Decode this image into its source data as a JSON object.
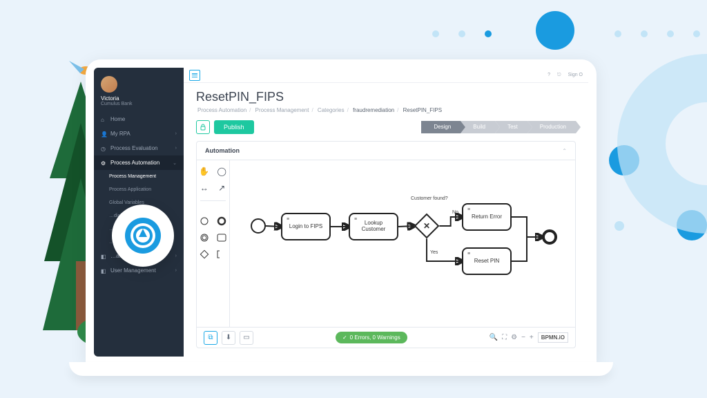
{
  "user": {
    "name": "Victoria",
    "subtitle": "Cumulus Bank"
  },
  "topbar": {
    "help": "?",
    "signout_icon": "⎋",
    "signout_label": "Sign O"
  },
  "sidebar": {
    "items": [
      {
        "icon": "⌂",
        "label": "Home"
      },
      {
        "icon": "👤",
        "label": "My RPA"
      },
      {
        "icon": "◷",
        "label": "Process Evaluation"
      },
      {
        "icon": "⚙",
        "label": "Process Automation",
        "active": true
      },
      {
        "icon": "",
        "label": "Process Management",
        "sub": true,
        "active": true
      },
      {
        "icon": "",
        "label": "Process Application",
        "sub": true
      },
      {
        "icon": "",
        "label": "Global Variables",
        "sub": true
      },
      {
        "icon": "",
        "label": "…dial Pool",
        "sub": true
      },
      {
        "icon": "",
        "label": "…ations",
        "sub": true
      },
      {
        "icon": "",
        "label": "…oring",
        "sub": true
      },
      {
        "icon": "◧",
        "label": "…anagement"
      },
      {
        "icon": "◧",
        "label": "User Management"
      }
    ]
  },
  "header": {
    "title": "ResetPIN_FIPS",
    "breadcrumb": [
      "Process Automation",
      "Process Management",
      "Categories",
      "fraudremediation",
      "ResetPIN_FIPS"
    ]
  },
  "actions": {
    "publish": "Publish"
  },
  "stages": [
    "Design",
    "Build",
    "Test",
    "Production"
  ],
  "active_stage": 0,
  "panel": {
    "title": "Automation"
  },
  "diagram": {
    "nodes": {
      "task1": "Login to FIPS",
      "task2": "Lookup Customer",
      "gateway_label": "Customer found?",
      "branch_no_label": "No",
      "branch_yes_label": "Yes",
      "task_no": "Return Error",
      "task_yes": "Reset PIN"
    }
  },
  "status": {
    "text": "0 Errors, 0 Warnings"
  },
  "footer": {
    "bpmn": "BPMN.iO"
  },
  "colors": {
    "accent": "#1aa8e6",
    "success": "#1ec8a0"
  }
}
